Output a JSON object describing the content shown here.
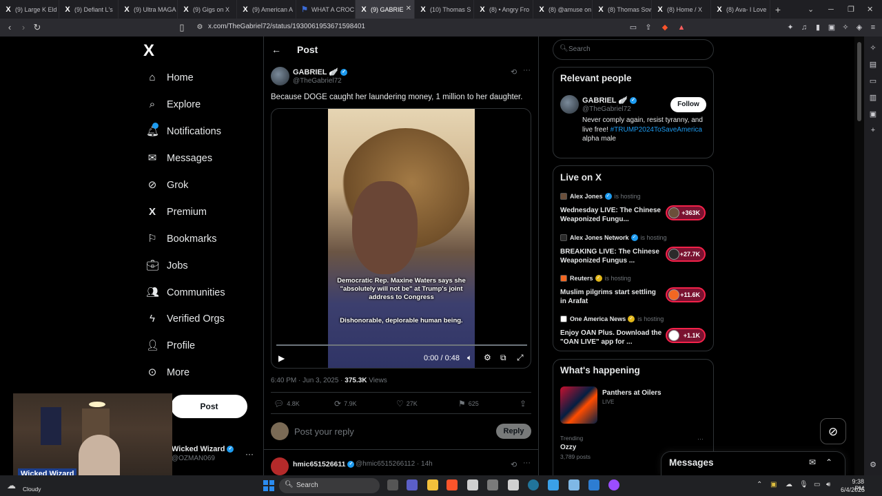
{
  "browser": {
    "tabs": [
      {
        "label": "(9) Large K Eld",
        "icon": "x-icon"
      },
      {
        "label": "(9) Defiant L's",
        "icon": "x-icon"
      },
      {
        "label": "(9) Ultra MAGA",
        "icon": "x-icon"
      },
      {
        "label": "(9) Gigs on X",
        "icon": "x-icon"
      },
      {
        "label": "(9) American A",
        "icon": "x-icon"
      },
      {
        "label": "WHAT A CROC",
        "icon": "flag-icon"
      },
      {
        "label": "(9) GABRIE",
        "icon": "x-icon",
        "active": true
      },
      {
        "label": "(10) Thomas S",
        "icon": "x-icon"
      },
      {
        "label": "(8) • Angry Fro",
        "icon": "x-icon"
      },
      {
        "label": "(8) @amuse on",
        "icon": "x-icon"
      },
      {
        "label": "(8) Thomas Sow",
        "icon": "x-icon"
      },
      {
        "label": "(8) Home / X",
        "icon": "x-icon"
      },
      {
        "label": "(8) Ava- I Love",
        "icon": "x-icon"
      }
    ],
    "url": "x.com/TheGabriel72/status/1930061953671598401"
  },
  "nav": {
    "logo": "X",
    "items": [
      {
        "label": "Home",
        "icon": "home-icon"
      },
      {
        "label": "Explore",
        "icon": "search-icon"
      },
      {
        "label": "Notifications",
        "icon": "bell-icon"
      },
      {
        "label": "Messages",
        "icon": "mail-icon"
      },
      {
        "label": "Grok",
        "icon": "grok-icon"
      },
      {
        "label": "Premium",
        "icon": "x-icon"
      },
      {
        "label": "Bookmarks",
        "icon": "bookmark-icon"
      },
      {
        "label": "Jobs",
        "icon": "briefcase-icon"
      },
      {
        "label": "Communities",
        "icon": "people-icon"
      },
      {
        "label": "Verified Orgs",
        "icon": "lightning-icon"
      },
      {
        "label": "Profile",
        "icon": "person-icon"
      },
      {
        "label": "More",
        "icon": "more-icon"
      }
    ],
    "post_button": "Post",
    "account": {
      "name": "Wicked Wizard",
      "handle": "@OZMAN069"
    }
  },
  "webcam": {
    "label": "Wicked Wizard"
  },
  "post": {
    "header": "Post",
    "author_name": "GABRIEL 🪽",
    "author_handle": "@TheGabriel72",
    "text": "Because DOGE caught her laundering money, 1 million to her daughter.",
    "video": {
      "caption_top": "Democratic Rep. Maxine Waters says she \"absolutely will not be\" at Trump's joint address to Congress",
      "caption_bottom": "Dishonorable, deplorable human being.",
      "time": "0:00 / 0:48",
      "progress": 0
    },
    "timestamp": "6:40 PM · Jun 3, 2025 · ",
    "views_count": "375.3K",
    "views_label": " Views",
    "stats": {
      "replies": "4.8K",
      "reposts": "7.9K",
      "likes": "27K",
      "bookmarks": "625"
    },
    "reply_placeholder": "Post your reply",
    "reply_button": "Reply"
  },
  "first_reply": {
    "name": "hmic651526611",
    "handle": "@hmic6515266112 · 14h"
  },
  "sidebar": {
    "search_placeholder": "Search",
    "relevant_people": {
      "title": "Relevant people",
      "name": "GABRIEL 🪽",
      "handle": "@TheGabriel72",
      "follow": "Follow",
      "bio_text": "Never comply again, resist tyranny, and live free!",
      "bio_link": "#TRUMP2024ToSaveAmerica",
      "bio_tail": " alpha male"
    },
    "live": {
      "title": "Live on X",
      "items": [
        {
          "host": "Alex Jones",
          "hosting": "is hosting",
          "title": "Wednesday LIVE: The Chinese Weaponized Fungu...",
          "count": "+363K",
          "color": "#6b4f3a"
        },
        {
          "host": "Alex Jones Network",
          "hosting": "is hosting",
          "title": "BREAKING LIVE: The Chinese Weaponized Fungus ...",
          "count": "+27.7K",
          "color": "#2a2a2a"
        },
        {
          "host": "Reuters",
          "hosting": "is hosting",
          "title": "Muslim pilgrims start settling in Arafat",
          "count": "+11.6K",
          "color": "#f26722"
        },
        {
          "host": "One America News",
          "hosting": "is hosting",
          "title": "Enjoy OAN Plus. Download the \"OAN LIVE\" app for ...",
          "count": "+1.1K",
          "color": "#ffffff"
        }
      ]
    },
    "happening": {
      "title": "What's happening",
      "event_title": "Panthers at Oilers",
      "event_status": "LIVE",
      "trending_label": "Trending",
      "trending_name": "Ozzy",
      "trending_count": "3,789 posts"
    },
    "messages": "Messages"
  },
  "taskbar": {
    "weather_temp": "",
    "weather_cond": "Cloudy",
    "search": "Search",
    "time": "9:38 PM",
    "date": "6/4/2025"
  },
  "colors": {
    "accent": "#1d9bf0",
    "live": "#f4224a"
  }
}
